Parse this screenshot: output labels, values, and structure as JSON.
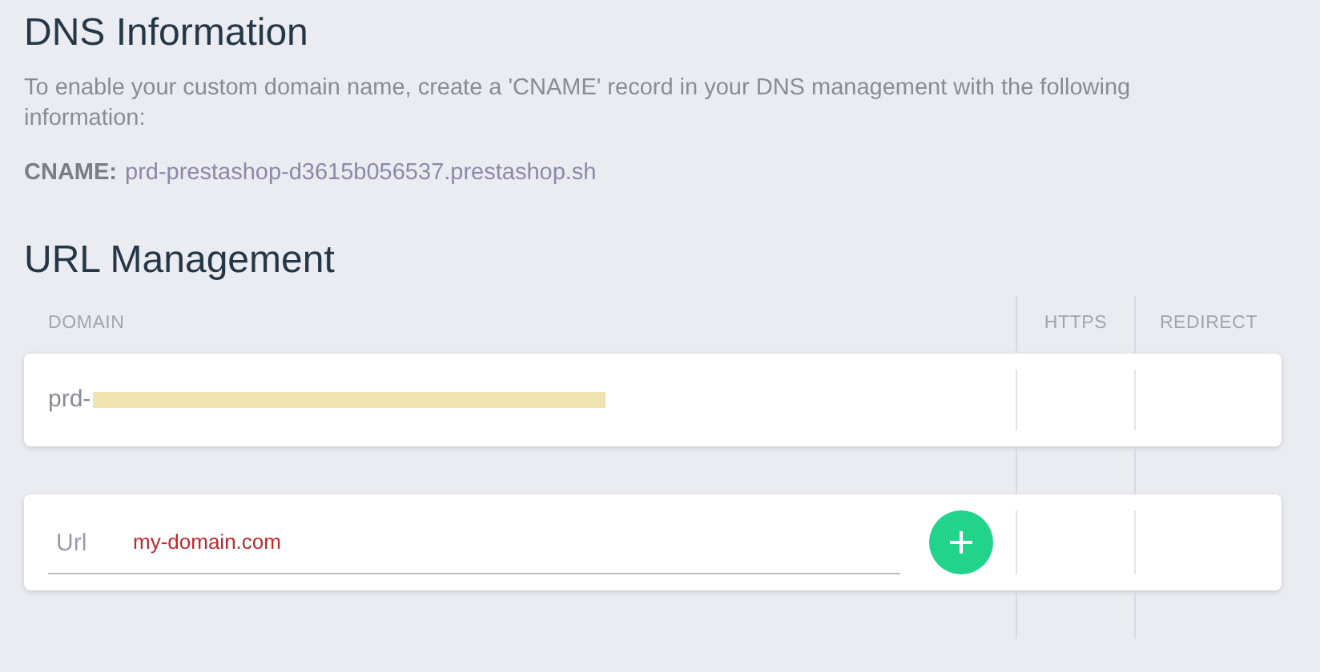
{
  "dns": {
    "title": "DNS Information",
    "description": "To enable your custom domain name, create a 'CNAME' record in your DNS management with the following information:",
    "cname_label": "CNAME:",
    "cname_value": "prd-prestashop-d3615b056537.prestashop.sh"
  },
  "url_management": {
    "title": "URL Management",
    "columns": [
      "DOMAIN",
      "HTTPS",
      "REDIRECT"
    ],
    "rows": [
      {
        "domain": "prd-",
        "redacted": true
      }
    ],
    "new_url": {
      "placeholder": "Url",
      "value": "my-domain.com"
    }
  }
}
